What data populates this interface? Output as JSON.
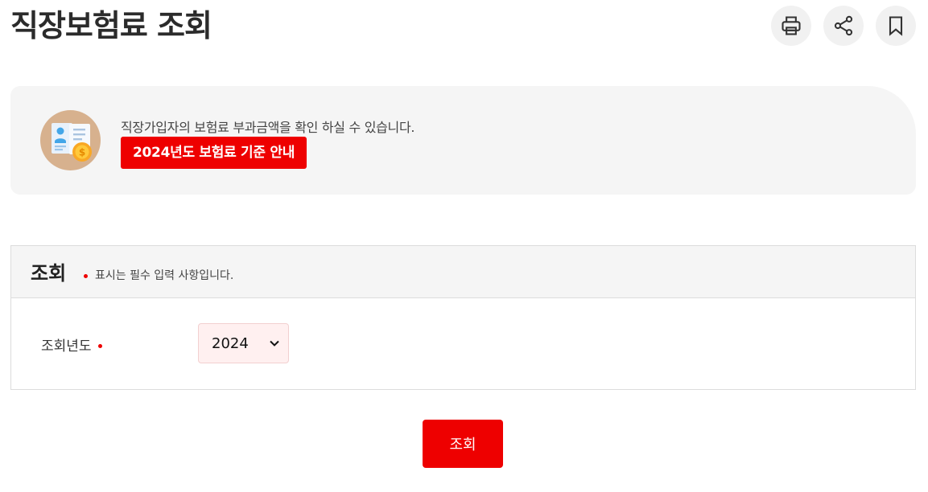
{
  "page": {
    "title": "직장보험료 조회"
  },
  "actions": [
    {
      "icon": "printer-icon"
    },
    {
      "icon": "share-icon"
    },
    {
      "icon": "bookmark-icon"
    }
  ],
  "info": {
    "description": "직장가입자의 보험료 부과금액을 확인 하실 수 있습니다.",
    "guide_link": "2024년도 보험료 기준 안내",
    "illustration": "insurance-document-coin-icon"
  },
  "form": {
    "title": "조회",
    "required_note": "표시는 필수 입력 사항입니다.",
    "year_label": "조회년도",
    "year_selected": "2024"
  },
  "submit": {
    "label": "조회"
  },
  "colors": {
    "accent": "#ee0000",
    "panel_bg": "#f5f5f5",
    "select_bg": "#fff0f0"
  }
}
